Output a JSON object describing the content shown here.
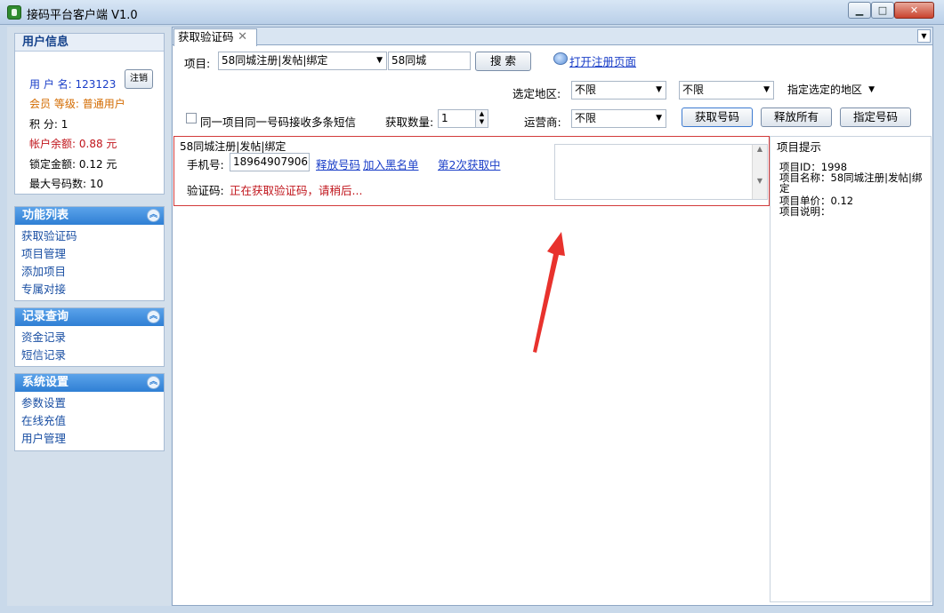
{
  "window": {
    "title": "接码平台客户端 V1.0",
    "min_label": "▁",
    "max_label": "□",
    "close_label": "✕"
  },
  "user_panel": {
    "header": "用户信息",
    "username_label": "用 户 名:",
    "username_value": "123123",
    "logout_label": "注销",
    "member_label": "会员 等级:",
    "member_value": "普通用户",
    "points_label": "积 分:",
    "points_value": "1",
    "balance_label": "帐户余额:",
    "balance_value": "0.88 元",
    "locked_label": "锁定金额:",
    "locked_value": "0.12 元",
    "maxnum_label": "最大号码数:",
    "maxnum_value": "10"
  },
  "func_panel": {
    "header": "功能列表",
    "items": [
      "获取验证码",
      "项目管理",
      "添加项目",
      "专属对接"
    ]
  },
  "records_panel": {
    "header": "记录查询",
    "items": [
      "资金记录",
      "短信记录"
    ]
  },
  "settings_panel": {
    "header": "系统设置",
    "items": [
      "参数设置",
      "在线充值",
      "用户管理"
    ]
  },
  "tabs": [
    {
      "label": "获取验证码"
    }
  ],
  "form": {
    "project_label": "项目:",
    "project_value": "58同城注册|发帖|绑定",
    "search_value": "58同城",
    "search_button": "搜 索",
    "open_reg_link": "打开注册页面",
    "region_label": "选定地区:",
    "region1_value": "不限",
    "region2_value": "不限",
    "region_mode_value": "指定选定的地区",
    "multi_sms_label": "同一项目同一号码接收多条短信",
    "qty_label": "获取数量:",
    "qty_value": "1",
    "carrier_label": "运营商:",
    "carrier_value": "不限",
    "get_number_button": "获取号码",
    "release_all_button": "释放所有",
    "assign_number_button": "指定号码"
  },
  "result": {
    "title": "58同城注册|发帖|绑定",
    "phone_label": "手机号:",
    "phone_value": "18964907906",
    "release_link": "释放号码",
    "blacklist_link": "加入黑名单",
    "status_link": "第2次获取中",
    "code_label": "验证码:",
    "code_status": "正在获取验证码，请稍后..."
  },
  "hint": {
    "title": "项目提示",
    "lines": [
      "项目ID：1998",
      "项目名称：58同城注册|发帖|绑定",
      "项目单价：0.12",
      "项目说明："
    ]
  },
  "colors": {
    "accent_blue": "#2f7fd4",
    "link_blue": "#1a3ec8",
    "alert_red": "#c0141b",
    "member_orange": "#d36b00",
    "arrow_red": "#e8322d"
  }
}
